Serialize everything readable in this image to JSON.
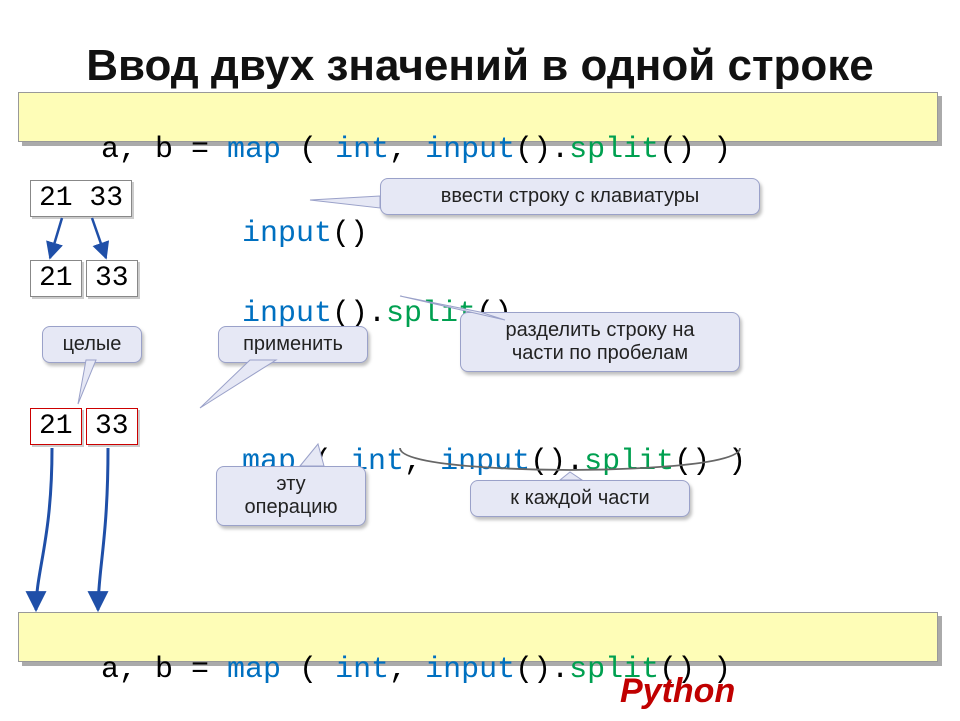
{
  "title": "Ввод двух значений в одной строке",
  "code_main": {
    "prefix": "a, b = ",
    "map": "map",
    "paren_open": " ( ",
    "int": "int",
    "comma": ", ",
    "input": "input",
    "empty_call": "().",
    "split": "split",
    "tail": "() )"
  },
  "row1": {
    "box": "21 33",
    "code_func": "input",
    "code_tail": "()"
  },
  "row2": {
    "box_a": "21",
    "box_b": "33",
    "code_func": "input",
    "dot": "().",
    "split": "split",
    "tail": "()"
  },
  "row3": {
    "box_a": "21",
    "box_b": "33",
    "map": "map",
    "po": " ( ",
    "int": "int",
    "comma": ", ",
    "input": "input",
    "dot": "().",
    "split": "split",
    "tail": "() )"
  },
  "bubbles": {
    "keyboard": "ввести строку с клавиатуры",
    "int_label": "целые",
    "apply": "применить",
    "splitspaces_l1": "разделить строку на",
    "splitspaces_l2": "части по пробелам",
    "thisop_l1": "эту",
    "thisop_l2": "операцию",
    "eachpart": "к каждой части"
  },
  "footer": "Python"
}
